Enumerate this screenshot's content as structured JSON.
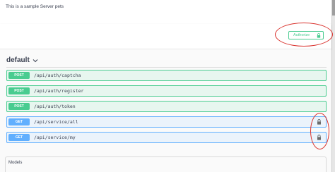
{
  "info": {
    "description": "This is a sample Server pets"
  },
  "auth": {
    "button_label": "Authorize",
    "lock_icon": "lock-icon"
  },
  "tag": {
    "name": "default",
    "chevron_icon": "chevron-down-icon"
  },
  "operations": [
    {
      "method": "POST",
      "path": "/api/auth/captcha",
      "locked": false
    },
    {
      "method": "POST",
      "path": "/api/auth/register",
      "locked": false
    },
    {
      "method": "POST",
      "path": "/api/auth/token",
      "locked": false
    },
    {
      "method": "GET",
      "path": "/api/service/all",
      "locked": true
    },
    {
      "method": "GET",
      "path": "/api/service/my",
      "locked": true
    }
  ],
  "models": {
    "title": "Models"
  },
  "colors": {
    "post": "#49cc90",
    "post_bg": "#e7f6ef",
    "get": "#61affe",
    "get_bg": "#ebf3fb",
    "annotation": "#d9302b",
    "text": "#3b4151"
  }
}
